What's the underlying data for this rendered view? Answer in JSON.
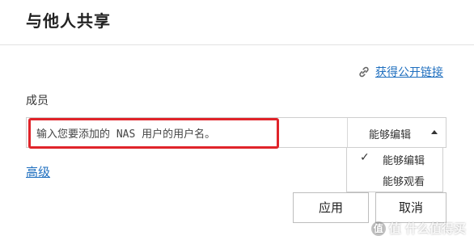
{
  "dialog": {
    "title": "与他人共享",
    "public_link_label": "获得公开链接",
    "members_label": "成员",
    "username_placeholder": "输入您要添加的 NAS 用户的用户名。",
    "permission": {
      "selected": "能够编辑",
      "options": [
        "能够编辑",
        "能够观看"
      ],
      "checked_option": "能够编辑"
    },
    "advanced_label": "高级",
    "buttons": {
      "apply": "应用",
      "cancel": "取消"
    }
  },
  "watermark": {
    "text": "值 什么值得买",
    "mark": "值"
  },
  "colors": {
    "link": "#1f6fbf",
    "highlight_border": "#e0242a",
    "border": "#cfcfcf"
  },
  "icons": {
    "public_link": "link-icon",
    "dropdown_caret": "caret-up-icon",
    "checked": "checkmark-icon"
  }
}
